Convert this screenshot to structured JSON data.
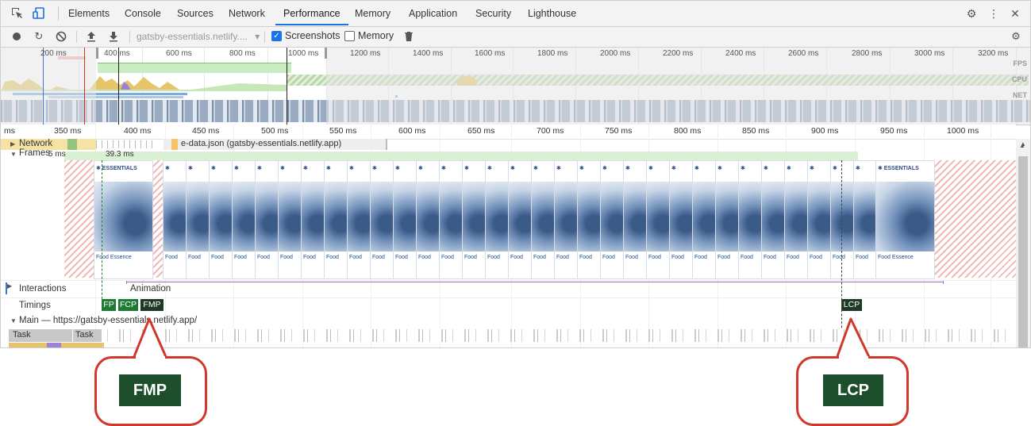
{
  "tabs": [
    "Elements",
    "Console",
    "Sources",
    "Network",
    "Performance",
    "Memory",
    "Application",
    "Security",
    "Lighthouse"
  ],
  "active_tab": "Performance",
  "toolbar": {
    "url_select": "gatsby-essentials.netlify....",
    "screenshots_label": "Screenshots",
    "screenshots_checked": true,
    "memory_label": "Memory",
    "memory_checked": false
  },
  "overview": {
    "ticks": [
      "200 ms",
      "400 ms",
      "600 ms",
      "800 ms",
      "1000 ms",
      "1200 ms",
      "1400 ms",
      "1600 ms",
      "1800 ms",
      "2000 ms",
      "2200 ms",
      "2400 ms",
      "2600 ms",
      "2800 ms",
      "3000 ms",
      "3200 ms"
    ],
    "lanes": [
      "FPS",
      "CPU",
      "NET"
    ]
  },
  "ruler": {
    "ticks": [
      "ms",
      "350 ms",
      "400 ms",
      "450 ms",
      "500 ms",
      "550 ms",
      "600 ms",
      "650 ms",
      "700 ms",
      "750 ms",
      "800 ms",
      "850 ms",
      "900 ms",
      "950 ms",
      "1000 ms"
    ]
  },
  "tracks": {
    "network": "Network",
    "network_request": "e-data.json (gatsby-essentials.netlify.app)",
    "frames": "Frames",
    "frames_ms_left": "5 ms",
    "frames_ms": "39.3 ms",
    "interactions": "Interactions",
    "animation": "Animation",
    "timings": "Timings",
    "main": "Main — https://gatsby-essentials.netlify.app/",
    "task_labels": [
      "Task",
      "Task"
    ]
  },
  "frame_thumb": {
    "brand": "ESSENTIALS",
    "footer": "Food Essence"
  },
  "timings": [
    "FP",
    "FCP",
    "FMP",
    "LCP"
  ],
  "callouts": [
    "FMP",
    "LCP"
  ],
  "colors": {
    "accent": "#1a73e8",
    "timing_green": "#1e7b34",
    "timing_dark": "#1d3a25",
    "callout_border": "#d0382b",
    "callout_fill": "#1d4f2c"
  }
}
